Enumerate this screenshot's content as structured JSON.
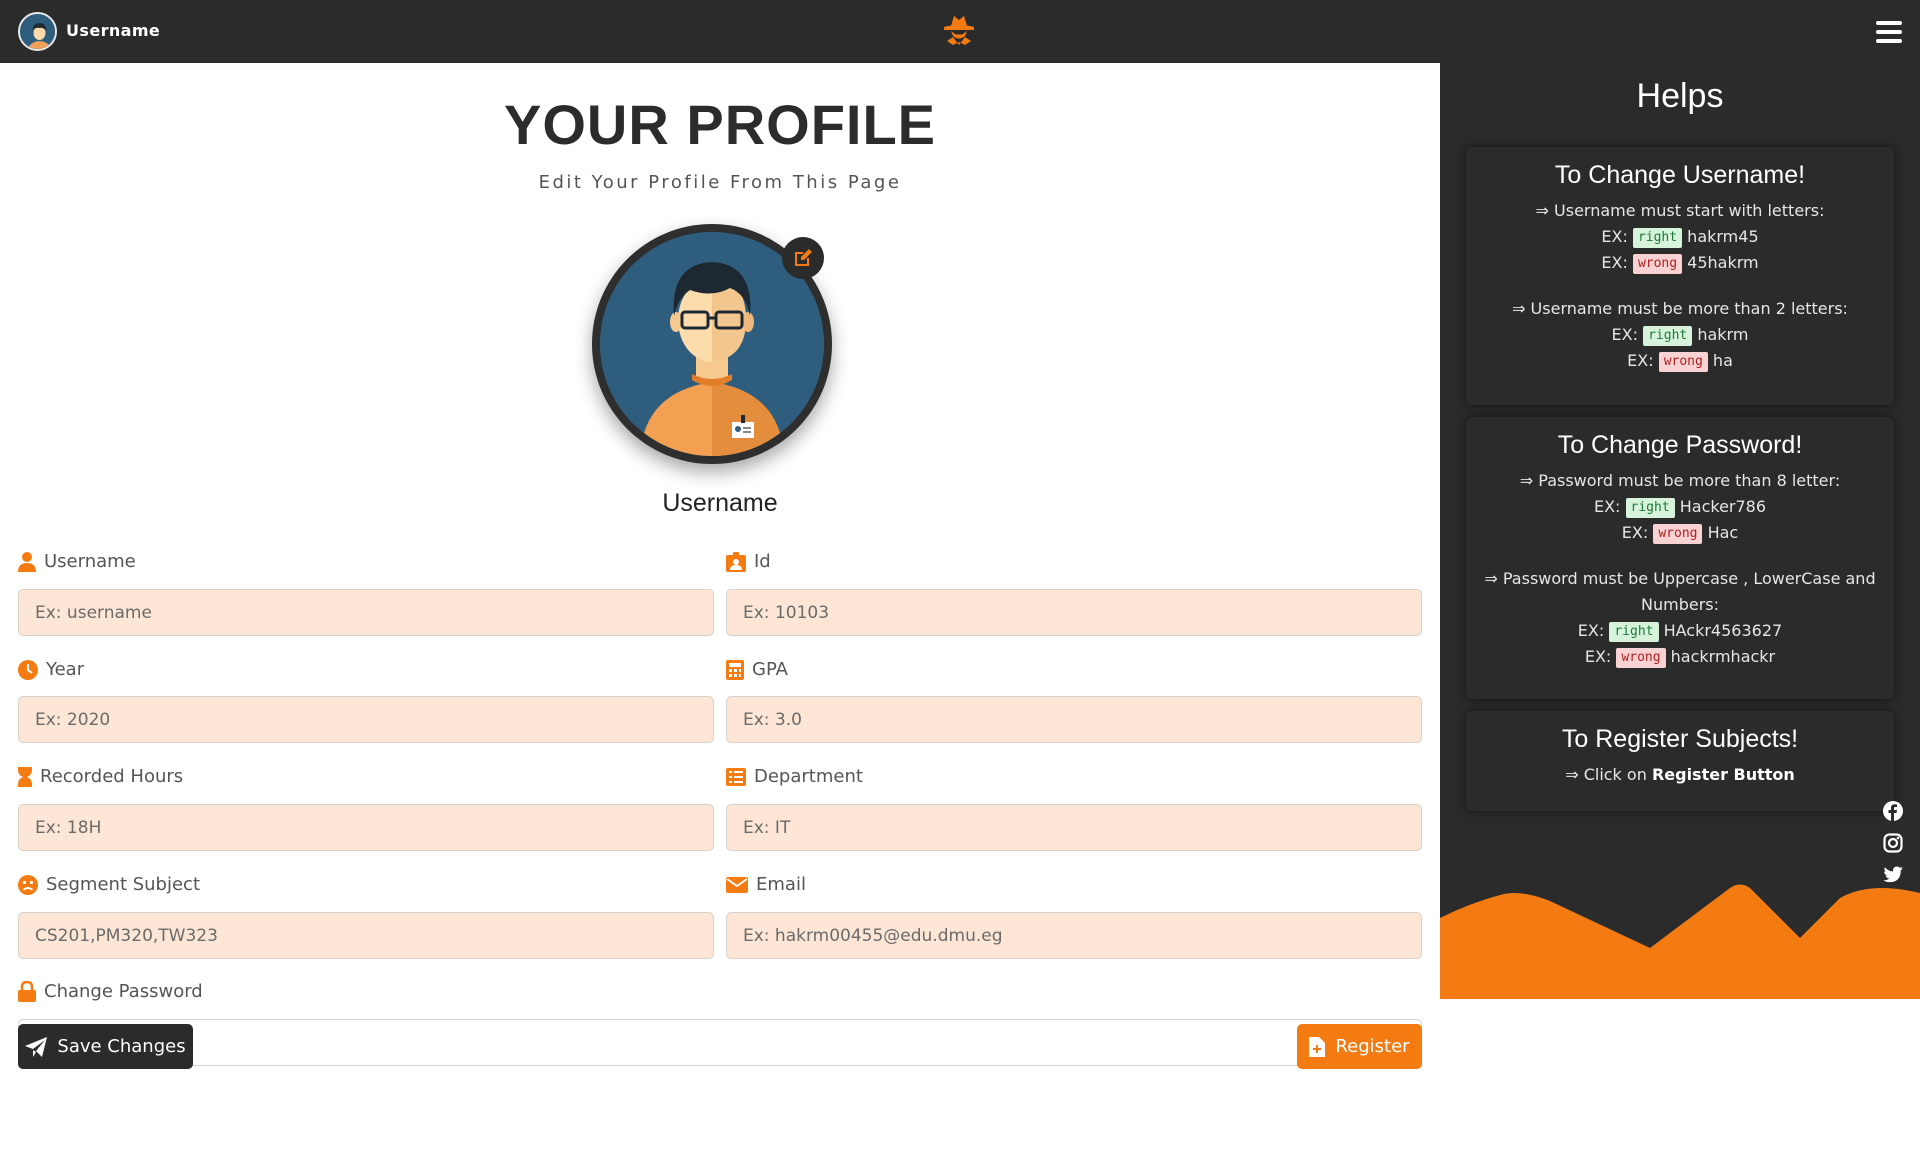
{
  "topbar": {
    "username": "Username",
    "avatar_icon": "user-avatar-icon",
    "logo_icon": "hacker-logo-icon",
    "menu_icon": "hamburger-menu-icon"
  },
  "profile": {
    "title": "YOUR PROFILE",
    "subtitle": "Edit Your Profile From This Page",
    "name": "Username"
  },
  "form": {
    "username": {
      "label": "Username",
      "placeholder": "Ex: username"
    },
    "id": {
      "label": "Id",
      "placeholder": "Ex: 10103"
    },
    "year": {
      "label": "Year",
      "placeholder": "Ex: 2020"
    },
    "gpa": {
      "label": "GPA",
      "placeholder": "Ex: 3.0"
    },
    "recorded_hours": {
      "label": "Recorded Hours",
      "placeholder": "Ex: 18H"
    },
    "department": {
      "label": "Department",
      "placeholder": "Ex: IT"
    },
    "segment_subject": {
      "label": "Segment Subject",
      "placeholder": "CS201,PM320,TW323"
    },
    "email": {
      "label": "Email",
      "placeholder": "Ex: hakrm00455@edu.dmu.eg"
    },
    "password": {
      "label": "Change Password",
      "placeholder": ""
    },
    "save_label": "Save Changes",
    "register_label": "Register"
  },
  "helps": {
    "title": "Helps",
    "username_card": {
      "title": "To Change Username!",
      "rule1": "⇒ Username must start with letters:",
      "ex_prefix": "EX:",
      "right_tag": "right",
      "wrong_tag": "wrong",
      "rule1_right": "hakrm45",
      "rule1_wrong": "45hakrm",
      "rule2": "⇒ Username must be more than 2 letters:",
      "rule2_right": "hakrm",
      "rule2_wrong": "ha"
    },
    "password_card": {
      "title": "To Change Password!",
      "rule1": "⇒ Password must be more than 8 letter:",
      "ex_prefix": "EX:",
      "right_tag": "right",
      "wrong_tag": "wrong",
      "rule1_right": "Hacker786",
      "rule1_wrong": "Hac",
      "rule2": "⇒ Password must be Uppercase , LowerCase and Numbers:",
      "rule2_right": "HAckr4563627",
      "rule2_wrong": "hackrmhackr"
    },
    "register_card": {
      "title": "To Register Subjects!",
      "text": "⇒ Click on",
      "bold": "Register Button"
    }
  },
  "social": [
    "facebook-icon",
    "instagram-icon",
    "twitter-icon"
  ],
  "colors": {
    "accent": "#f47b12",
    "dark": "#2b2b2b",
    "input_bg": "#fde6d6"
  }
}
